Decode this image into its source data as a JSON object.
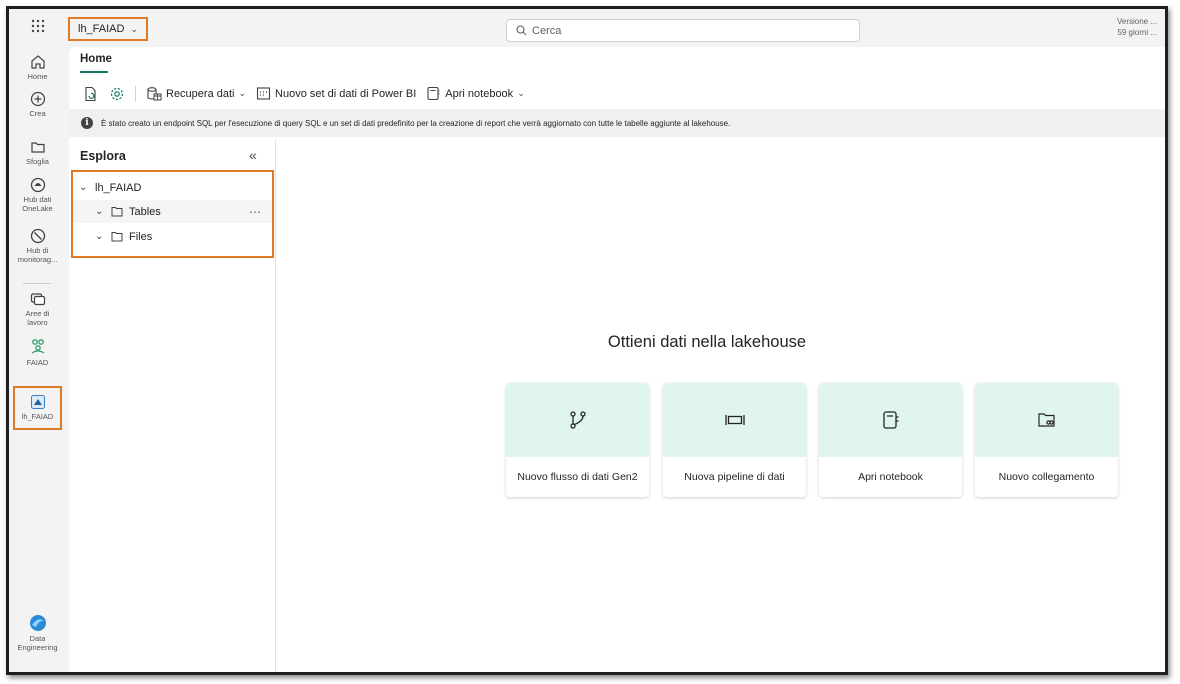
{
  "header": {
    "workspace": "lh_FAIAD",
    "search_placeholder": "Cerca",
    "version_line1": "Versione ...",
    "version_line2": "59 giorni ..."
  },
  "rail": {
    "home": "Home",
    "create": "Crea",
    "browse": "Sfoglia",
    "onelake_line1": "Hub dati",
    "onelake_line2": "OneLake",
    "monitor_line1": "Hub di",
    "monitor_line2": "monitorag...",
    "workspaces_line1": "Aree di",
    "workspaces_line2": "lavoro",
    "faiad": "FAIAD",
    "lakehouse": "lh_FAIAD",
    "experience_line1": "Data",
    "experience_line2": "Engineering"
  },
  "tabs": {
    "home": "Home"
  },
  "toolbar": {
    "get_data": "Recupera dati",
    "new_dataset": "Nuovo set di dati di Power BI",
    "open_notebook": "Apri notebook"
  },
  "info_message": "È stato creato un endpoint SQL per l'esecuzione di query SQL e un set di dati predefinito per la creazione di report che verrà aggiornato con tutte le tabelle aggiunte al lakehouse.",
  "explorer": {
    "title": "Esplora",
    "root": "lh_FAIAD",
    "items": [
      "Tables",
      "Files"
    ]
  },
  "empty_state": {
    "title": "Ottieni dati nella lakehouse",
    "cards": [
      "Nuovo flusso di dati Gen2",
      "Nuova pipeline di dati",
      "Apri notebook",
      "Nuovo collegamento"
    ]
  },
  "colors": {
    "accent": "#117865",
    "highlight_border": "#e07b24",
    "card_top": "#e0f5ee"
  }
}
